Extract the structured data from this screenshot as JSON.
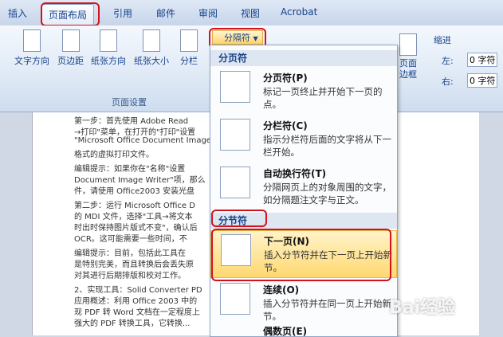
{
  "tabs": [
    "插入",
    "页面布局",
    "引用",
    "邮件",
    "审阅",
    "视图",
    "Acrobat"
  ],
  "ribbon": {
    "buttons": [
      "文字方向",
      "页边距",
      "纸张方向",
      "纸张大小",
      "分栏"
    ],
    "group_label": "页面设置",
    "break_button": "分隔符",
    "page_border": "页面边框",
    "indent_label": "缩进",
    "indent_left": "左:",
    "indent_right": "右:",
    "indent_left_value": "0 字符",
    "indent_right_value": "0 字符"
  },
  "menu": {
    "page_breaks_header": "分页符",
    "section_breaks_header": "分节符",
    "items": [
      {
        "title": "分页符(P)",
        "desc": "标记一页终止并开始下一页的点。"
      },
      {
        "title": "分栏符(C)",
        "desc": "指示分栏符后面的文字将从下一栏开始。"
      },
      {
        "title": "自动换行符(T)",
        "desc": "分隔网页上的对象周围的文字，如分隔题注文字与正文。"
      },
      {
        "title": "下一页(N)",
        "desc": "插入分节符并在下一页上开始新节。"
      },
      {
        "title": "连续(O)",
        "desc": "插入分节符并在同一页上开始新节。"
      },
      {
        "title": "偶数页(E)",
        "desc": ""
      }
    ]
  },
  "document_lines": [
    "第一步：首先使用 Adobe Read",
    "→打印\"菜单，在打开的\"打印\"设置",
    "\"Microsoft Office Document Image",
    "格式的虚拟打印文件。",
    "编辑提示：如果你在\"名称\"设置",
    "Document Image Writer\"项，那么",
    "件，请使用 Office2003 安装光盘",
    "第二步：运行 Microsoft Office D",
    "的 MDI 文件，选择\"工具→将文本",
    "时出时保持图片版式不变\"，确认后",
    "OCR。这可能需要一些时间，不",
    "编辑提示：目前，包括此工具在",
    "是特别完美，而且转换后会丢失原",
    "对其进行后期排版和校对工作。",
    "2、实现工具：Solid Converter PD",
    "应用概述：利用 Office 2003 中的",
    "现 PDF 转 Word 文档在一定程度上",
    "强大的 PDF 转换工具，它转换..."
  ],
  "watermark": "Bai经验"
}
